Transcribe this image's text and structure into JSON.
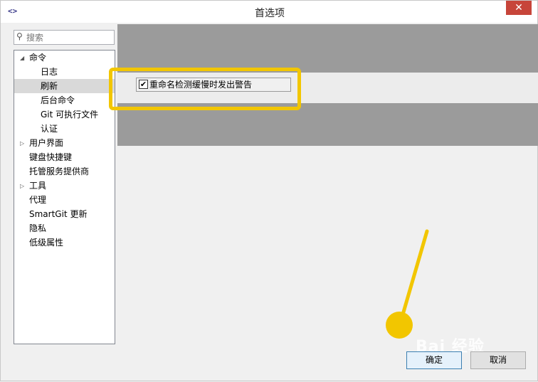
{
  "window": {
    "title": "首选项"
  },
  "search": {
    "placeholder": "搜索",
    "value": ""
  },
  "tree": {
    "command": "命令",
    "log": "日志",
    "refresh": "刷新",
    "background_commands": "后台命令",
    "git_executable": "Git 可执行文件",
    "auth": "认证",
    "user_interface": "用户界面",
    "keyboard_shortcuts": "键盘快捷键",
    "hosting_providers": "托管服务提供商",
    "tools": "工具",
    "proxy": "代理",
    "smartgit_update": "SmartGit 更新",
    "privacy": "隐私",
    "low_level_properties": "低级属性"
  },
  "settings": {
    "rename_warning_label": "重命名检测缓慢时发出警告",
    "rename_warning_checked": true
  },
  "buttons": {
    "ok": "确定",
    "cancel": "取消"
  },
  "watermark": "Bai 经验",
  "colors": {
    "highlight": "#f2c600",
    "selected": "#d9d9d9"
  }
}
